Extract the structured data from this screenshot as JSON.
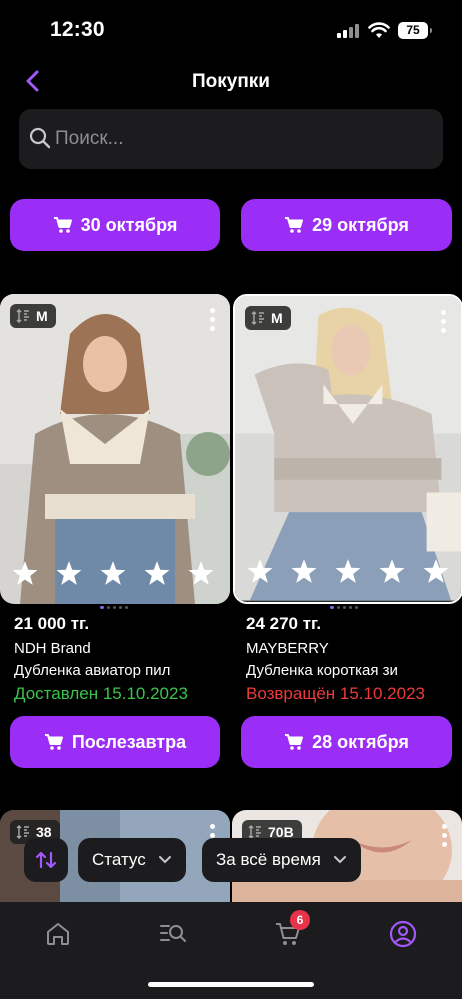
{
  "status_bar": {
    "time": "12:30",
    "battery": "75"
  },
  "header": {
    "title": "Покупки"
  },
  "search": {
    "placeholder": "Поиск..."
  },
  "date_buttons": [
    {
      "label": "30 октября"
    },
    {
      "label": "29 октября"
    }
  ],
  "products": [
    {
      "size": "M",
      "price": "21 000 тг.",
      "brand": "NDH Brand",
      "name": "Дубленка авиатор пил",
      "status": "Доставлен 15.10.2023",
      "status_color": "#3cc34e",
      "button_label": "Послезавтра"
    },
    {
      "size": "M",
      "price": "24 270 тг.",
      "brand": "MAYBERRY",
      "name": "Дубленка короткая зи",
      "status": "Возвращён 15.10.2023",
      "status_color": "#ee3a3a",
      "button_label": "28 октября"
    }
  ],
  "next_products": [
    {
      "size": "38"
    },
    {
      "size": "70B"
    }
  ],
  "filters": {
    "status_label": "Статус",
    "period_label": "За всё время"
  },
  "tabbar": {
    "cart_count": "6"
  },
  "colors": {
    "accent": "#9b2ef6",
    "background": "#000000",
    "surface": "#1c1c1e"
  }
}
